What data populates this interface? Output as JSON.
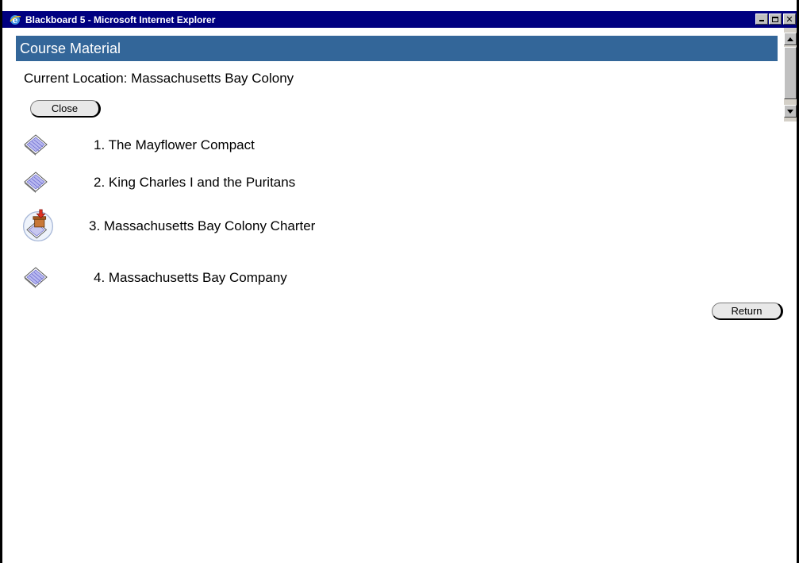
{
  "window": {
    "title": "Blackboard 5 - Microsoft Internet Explorer"
  },
  "header": {
    "title": "Course Material"
  },
  "location": {
    "text": "Current Location: Massachusetts Bay Colony"
  },
  "buttons": {
    "close_label": "Close",
    "return_label": "Return"
  },
  "items": [
    {
      "label": "1. The Mayflower Compact",
      "icon": "document-icon"
    },
    {
      "label": "2. King Charles I and the Puritans",
      "icon": "document-icon"
    },
    {
      "label": "3. Massachusetts Bay Colony Charter",
      "icon": "document-download-icon"
    },
    {
      "label": "4. Massachusetts Bay Company",
      "icon": "document-icon"
    }
  ],
  "colors": {
    "title_bar": "#000080",
    "header_bar": "#336699",
    "button_face": "#e8e8e8"
  }
}
